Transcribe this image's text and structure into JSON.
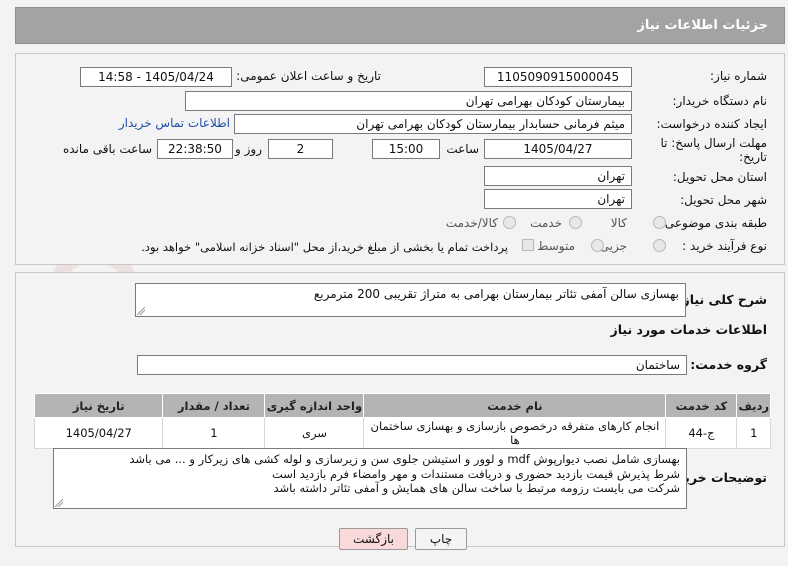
{
  "header": {
    "title": "جزئیات اطلاعات نیاز"
  },
  "form": {
    "need_number_label": "شماره نیاز:",
    "need_number_value": "1105090915000045",
    "announce_label": "تاریخ و ساعت اعلان عمومی:",
    "announce_value": "1405/04/24 - 14:58",
    "buyer_org_label": "نام دستگاه خریدار:",
    "buyer_org_value": "بیمارستان کودکان بهرامی تهران",
    "creator_label": "ایجاد کننده درخواست:",
    "creator_value": "میثم  فرمانی حسابدار بیمارستان کودکان بهرامی تهران",
    "buyer_contact_link": "اطلاعات تماس خریدار",
    "deadline_label_line1": "مهلت ارسال پاسخ: تا",
    "deadline_label_line2": "تاریخ:",
    "deadline_date": "1405/04/27",
    "time_label": "ساعت",
    "deadline_time": "15:00",
    "days_value": "2",
    "days_label": "روز و",
    "remaining_time": "22:38:50",
    "remaining_label": "ساعت باقی مانده",
    "province_label": "استان محل تحویل:",
    "province_value": "تهران",
    "city_label": "شهر محل تحویل:",
    "city_value": "تهران",
    "category_label": "طبقه بندی موضوعی:",
    "category_options": [
      "کالا",
      "خدمت",
      "کالا/خدمت"
    ],
    "category_selected": "خدمت",
    "process_label": "نوع فرآیند خرید :",
    "process_options": [
      "جزیی",
      "متوسط"
    ],
    "process_selected": "جزیی",
    "payment_note": "پرداخت تمام یا بخشی از مبلغ خرید،از محل \"اسناد خزانه اسلامی\" خواهد بود."
  },
  "summary": {
    "label": "شرح کلی نیاز:",
    "value": "بهسازی سالن آمفی تئاتر بیمارستان بهرامی به متراژ تقریبی 200 مترمربع"
  },
  "services": {
    "section_title": "اطلاعات خدمات مورد نیاز",
    "group_label": "گروه خدمت:",
    "group_value": "ساختمان",
    "columns": [
      "ردیف",
      "کد خدمت",
      "نام خدمت",
      "واحد اندازه گیری",
      "تعداد / مقدار",
      "تاریخ نیاز"
    ],
    "rows": [
      [
        "1",
        "ج-44",
        "انجام کارهای متفرقه درخصوص بازسازی و بهسازی ساختمان ها",
        "سری",
        "1",
        "1405/04/27"
      ]
    ]
  },
  "buyer_notes": {
    "label": "توضیحات خریدار:",
    "lines": [
      "بهسازی شامل نصب دیوارپوش mdf و لوور و استیشن جلوی سن و زیرسازی و لوله کشی های زیرکار و ... می باشد",
      "شرط پذیرش قیمت بازدید حضوری و دریافت مستندات و مهر وامضاء فرم بازدید است",
      "شرکت می بایست رزومه مرتبط با ساخت سالن های همایش و آمفی تئاتر داشته باشد"
    ]
  },
  "buttons": {
    "print": "چاپ",
    "back": "بازگشت"
  },
  "colors": {
    "header_bg": "#a3a3a3",
    "table_header_bg": "#b4b4b4",
    "link": "#1e4fa8",
    "back_button_bg": "#f9d9d9"
  },
  "watermark_text": "AriaTender.neT"
}
